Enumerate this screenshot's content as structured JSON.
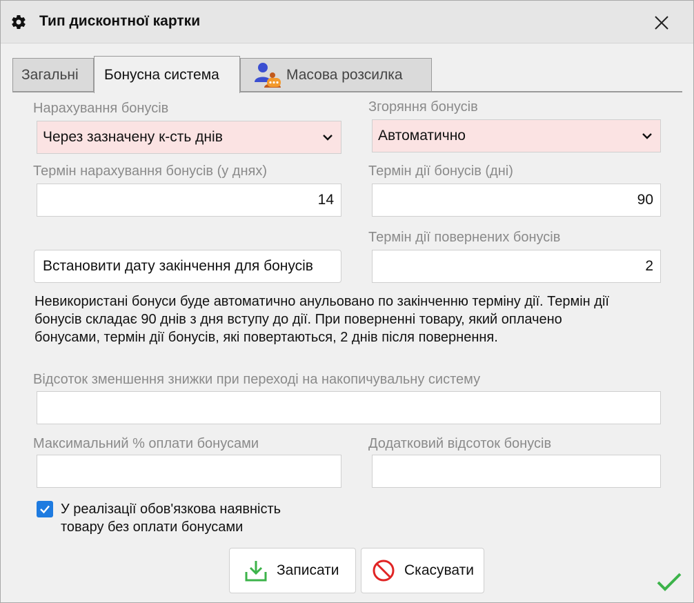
{
  "window": {
    "title": "Тип дисконтної картки",
    "title_icon": "gear-icon",
    "close_icon": "close-icon"
  },
  "tabs": [
    {
      "label": "Загальні",
      "active": false
    },
    {
      "label": "Бонусна система",
      "active": true
    },
    {
      "label": "Масова розсилка",
      "active": false,
      "icon": "users-chat-icon"
    }
  ],
  "form": {
    "accrual_label": "Нарахування бонусів",
    "accrual_value": "Через зазначену к-сть днів",
    "burn_label": "Згоряння бонусів",
    "burn_value": "Автоматично",
    "accrual_term_label": "Термін нарахування бонусів (у днях)",
    "accrual_term_value": "14",
    "validity_label": "Термін дії бонусів (дні)",
    "validity_value": "90",
    "returned_validity_label": "Термін дії повернених бонусів",
    "returned_validity_value": "2",
    "set_expiry_button": "Встановити дату закінчення для бонусів",
    "info_text": "Невикористані бонуси буде автоматично анульовано по закінченню терміну дії. Термін дії бонусів складає 90 днів з дня вступу до дії. При поверненні товару, який оплачено бонусами, термін дії бонусів, які повертаються, 2 днів після повернення.",
    "discount_reduction_label": "Відсоток зменшення знижки при переході на накопичувальну систему",
    "discount_reduction_value": "",
    "max_payment_label": "Максимальний % оплати бонусами",
    "max_payment_value": "",
    "extra_percent_label": "Додатковий відсоток бонусів",
    "extra_percent_value": "",
    "checkbox_label": "У реалізації обов'язкова наявність товару без оплати бонусами",
    "checkbox_checked": true
  },
  "actions": {
    "save_label": "Записати",
    "cancel_label": "Скасувати"
  },
  "colors": {
    "select_bg": "#fbe3e3",
    "checkbox": "#1e7be0",
    "save_icon": "#3cb34a",
    "cancel_icon": "#e02424",
    "status_check": "#3cb34a"
  }
}
